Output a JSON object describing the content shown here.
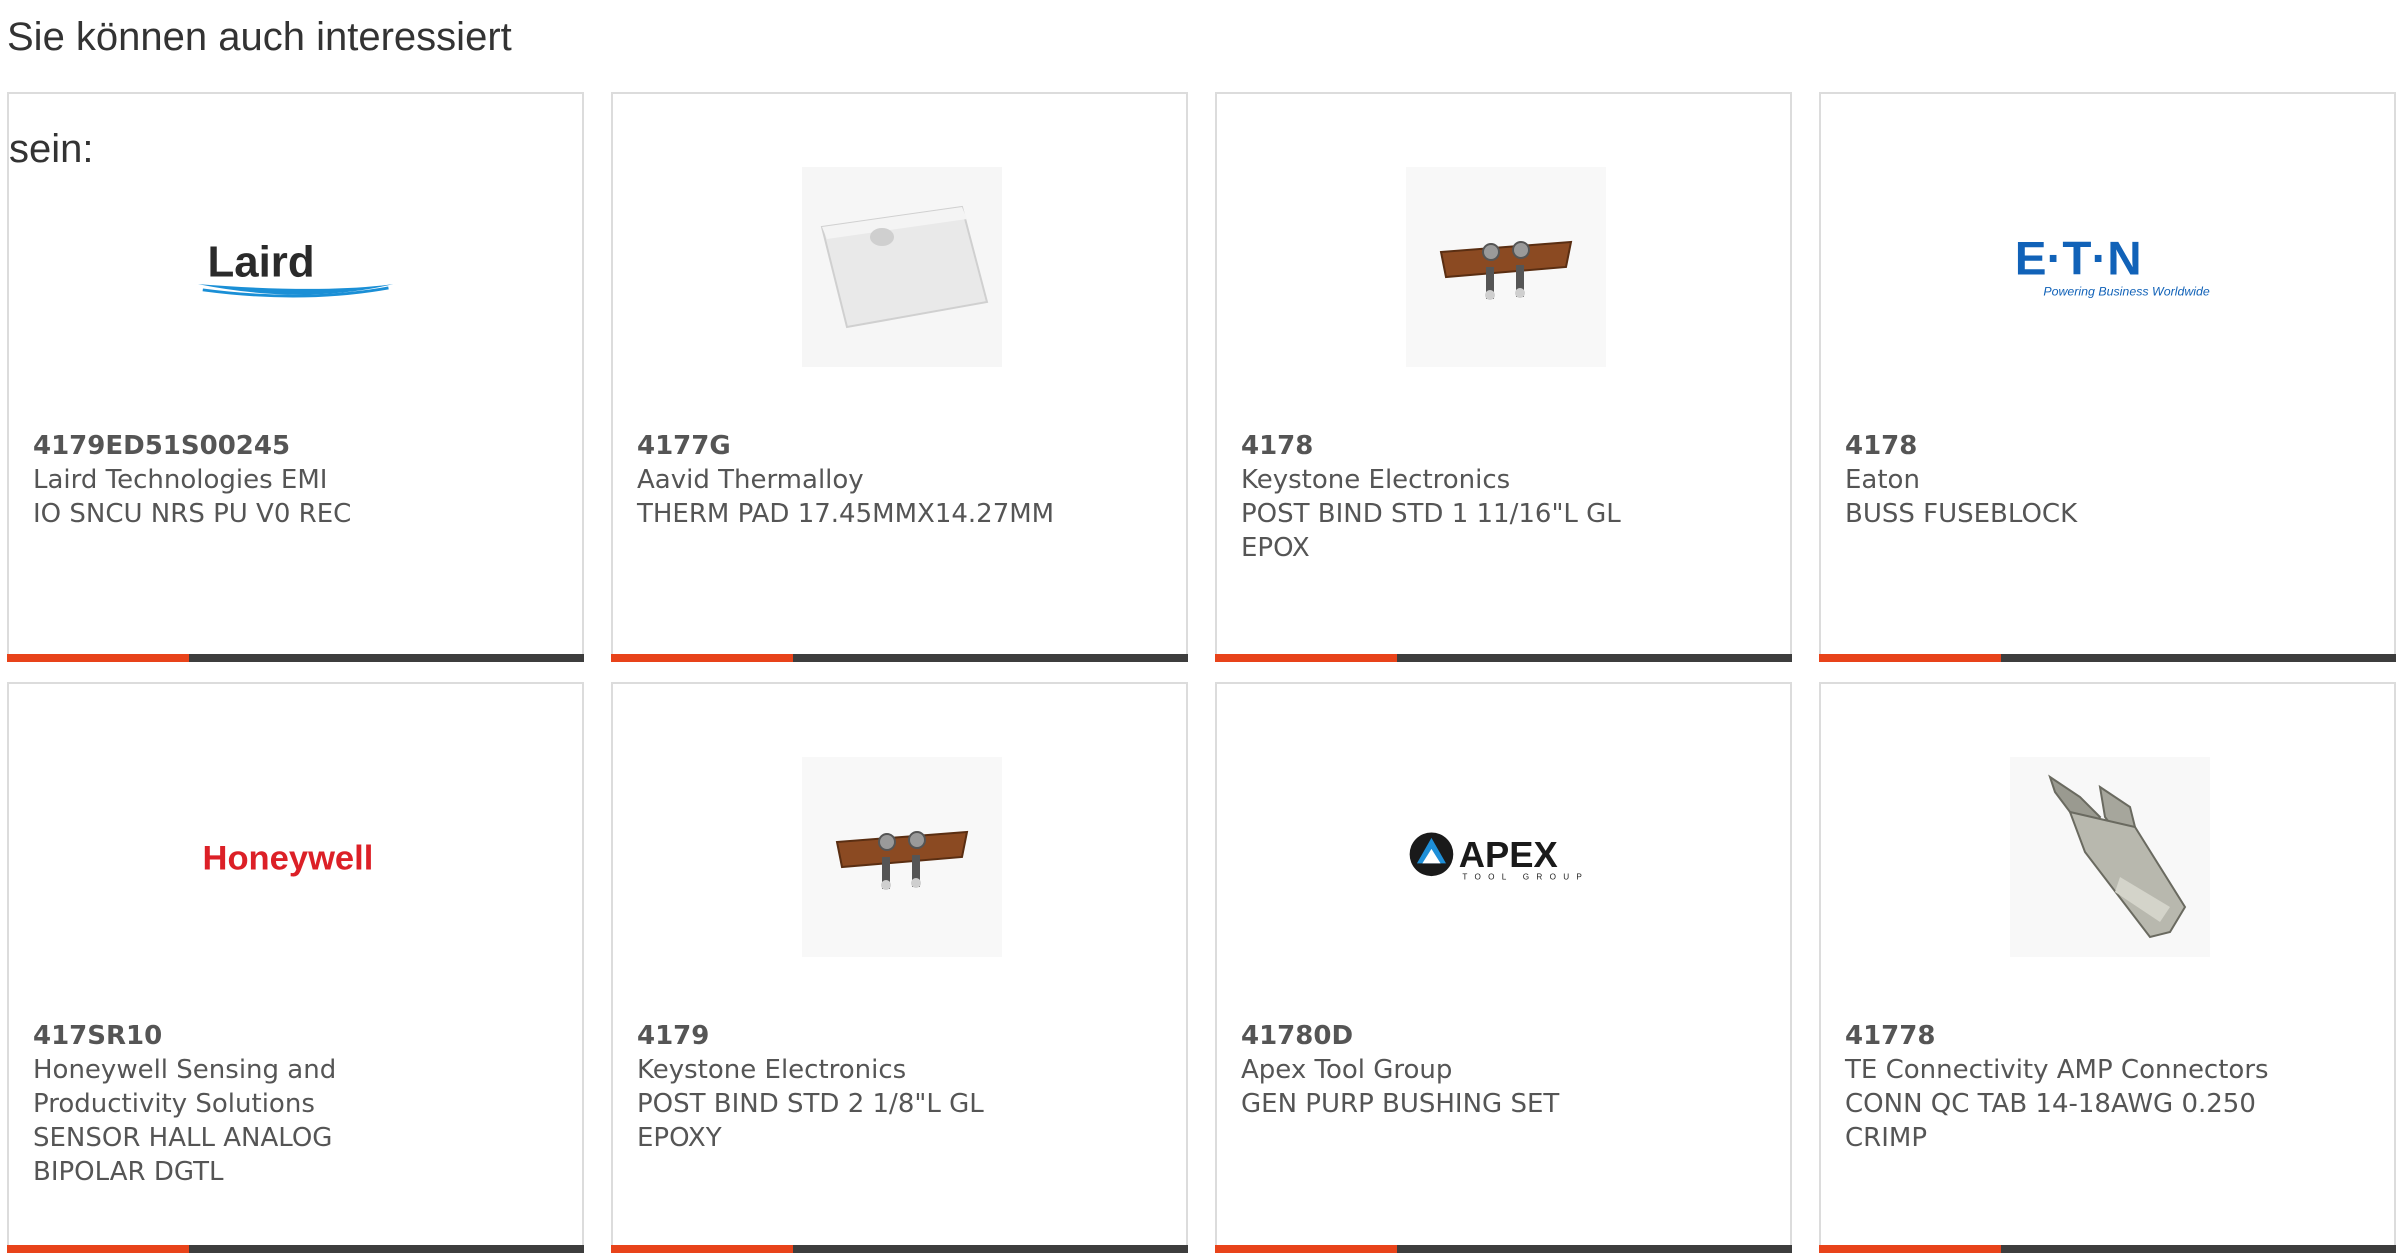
{
  "section": {
    "title_line1": "Sie können auch interessiert",
    "title_line2": "sein:"
  },
  "products": [
    {
      "part": "4179ED51S00245",
      "manufacturer": "Laird Technologies EMI",
      "description": "IO SNCU NRS PU V0 REC",
      "image": "laird-logo"
    },
    {
      "part": "4177G",
      "manufacturer": "Aavid Thermalloy",
      "description": "THERM PAD 17.45MMX14.27MM",
      "image": "therm-pad"
    },
    {
      "part": "4178",
      "manufacturer": "Keystone Electronics",
      "description": "POST BIND STD 1 11/16\"L GL EPOX",
      "image": "binding-post"
    },
    {
      "part": "4178",
      "manufacturer": "Eaton",
      "description": "BUSS FUSEBLOCK",
      "image": "eaton-logo",
      "logo_tagline": "Powering Business Worldwide"
    },
    {
      "part": "417SR10",
      "manufacturer": "Honeywell Sensing and Productivity Solutions",
      "description": "SENSOR HALL ANALOG BIPOLAR DGTL",
      "image": "honeywell-logo"
    },
    {
      "part": "4179",
      "manufacturer": "Keystone Electronics",
      "description": "POST BIND STD 2 1/8\"L GL EPOXY",
      "image": "binding-post"
    },
    {
      "part": "41780D",
      "manufacturer": "Apex Tool Group",
      "description": "GEN PURP BUSHING SET",
      "image": "apex-logo",
      "logo_tagline": "TOOL GROUP"
    },
    {
      "part": "41778",
      "manufacturer": "TE Connectivity AMP Connectors",
      "description": "CONN QC TAB 14-18AWG 0.250 CRIMP",
      "image": "quick-connect-tab"
    }
  ],
  "logos": {
    "laird": "Laird",
    "eaton": "E·T·N",
    "honeywell": "Honeywell",
    "apex": "APEX"
  },
  "colors": {
    "accent": "#e8431a",
    "bar": "#3d3d3d",
    "border": "#dcdcdc",
    "text": "#555555"
  }
}
